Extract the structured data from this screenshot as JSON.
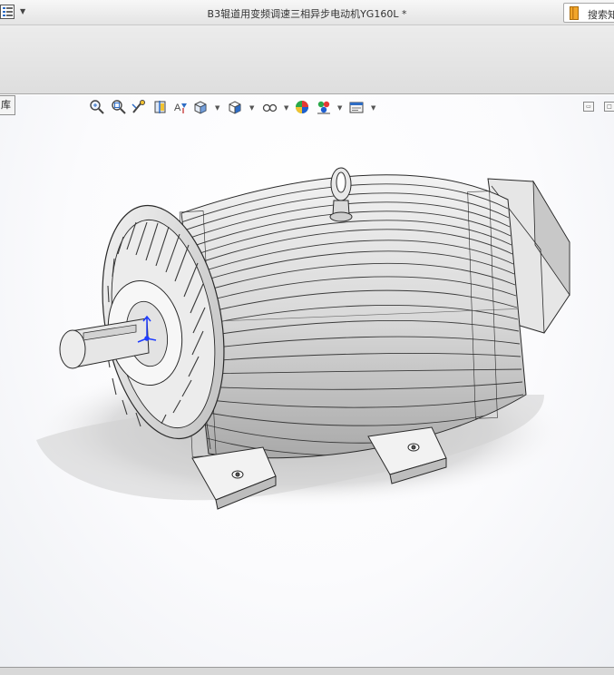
{
  "window": {
    "title": "B3辊道用变频调速三相异步电动机YG160L *",
    "menu_icon": "menu-list-icon",
    "search_label": "搜索知"
  },
  "viewport": {
    "tree_tab_label": "库",
    "toolbar_icons": [
      "zoom-to-fit-icon",
      "zoom-to-area-icon",
      "previous-view-icon",
      "section-view-icon",
      "dynamic-annotation-icon",
      "view-orientation-icon",
      "display-style-icon",
      "hide-show-items-icon",
      "edit-appearance-icon",
      "apply-scene-icon",
      "view-settings-icon"
    ],
    "window_controls": [
      "restore-icon",
      "maximize-icon"
    ]
  },
  "model": {
    "name": "YG160L motor",
    "body_color": "#d4d4d4",
    "shadow_color": "#b9b9b9",
    "edge_color": "#2a2a2a",
    "axis_color": "#1e3cff"
  }
}
